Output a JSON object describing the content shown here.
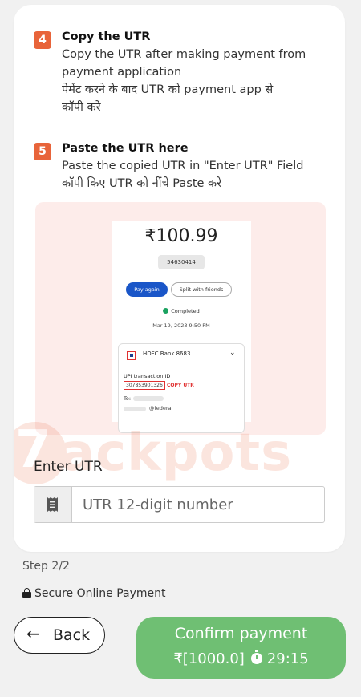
{
  "step4": {
    "number": "4",
    "title": "Copy the UTR",
    "line1": "Copy the UTR after making payment from",
    "line2": "payment application",
    "line3": "पेमेंट करने के बाद UTR को payment app से",
    "line4": "कॉपी करे"
  },
  "step5": {
    "number": "5",
    "title": "Paste the UTR here",
    "line1": "Paste the copied UTR in \"Enter UTR\" Field",
    "line2": "कॉपी किए UTR को नींचे Paste करे"
  },
  "example_screenshot": {
    "amount": "₹100.99",
    "reference": "54630414",
    "pay_again": "Pay again",
    "split": "Split with friends",
    "status": "Completed",
    "date": "Mar 19, 2023 9:50 PM",
    "bank": "HDFC Bank 8683",
    "upi_label": "UPI transaction ID",
    "upi_id": "307853901326",
    "copy_utr": "COPY UTR",
    "to_label": "To:",
    "handle": "@federal"
  },
  "watermark": "7 Jackpots",
  "utr": {
    "label": "Enter UTR",
    "placeholder": "UTR 12-digit number"
  },
  "footer": {
    "step": "Step 2/2",
    "secure": "Secure Online Payment"
  },
  "actions": {
    "back": "Back",
    "confirm": "Confirm payment",
    "amount": "₹[1000.0]",
    "timer": "29:15"
  },
  "colors": {
    "accent": "#e8643a",
    "confirm_bg": "#6fbf73",
    "background": "#f1f1f1"
  }
}
